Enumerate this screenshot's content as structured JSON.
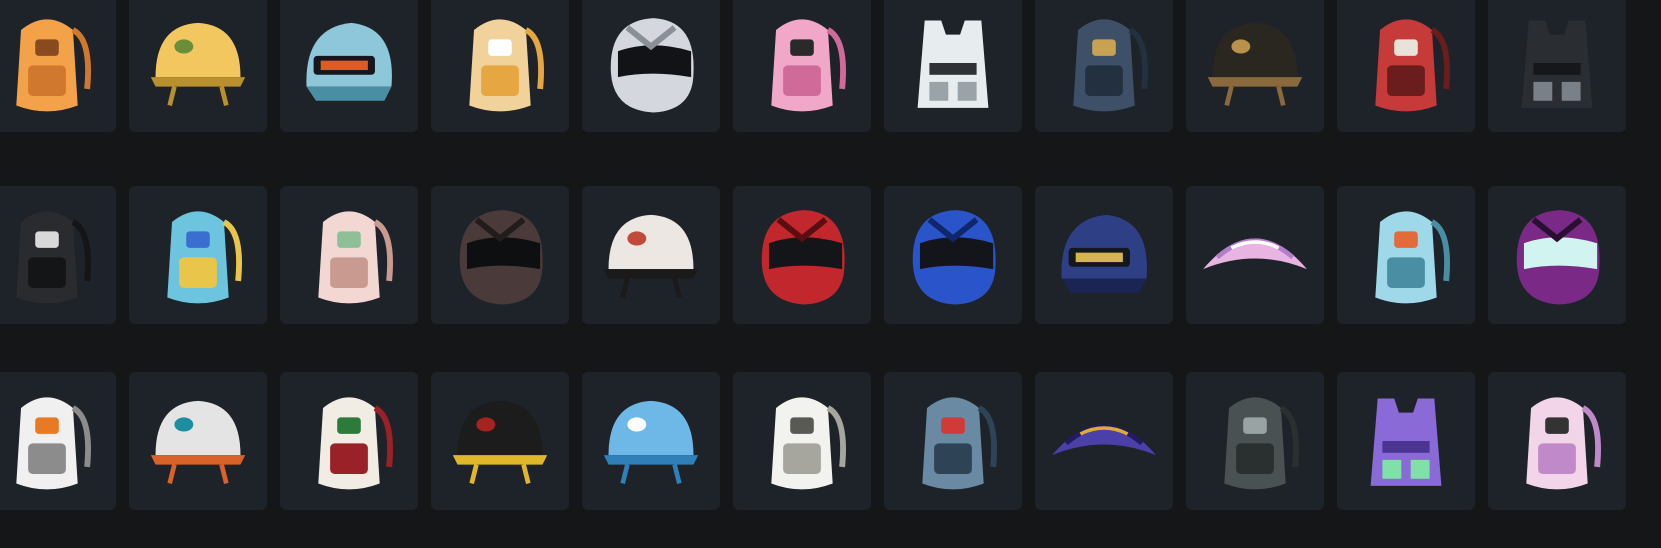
{
  "grid": {
    "rows": [
      {
        "items": [
          {
            "icon": "smiley-backpack-icon",
            "kind": "backpack",
            "c1": "#f4a24a",
            "c2": "#d0782e",
            "c3": "#8a4a20"
          },
          {
            "icon": "lemon-helmet-icon",
            "kind": "helmet",
            "c1": "#f2c760",
            "c2": "#b8902e",
            "c3": "#6a8f3a"
          },
          {
            "icon": "blue-level3-helmet-icon",
            "kind": "helmet3",
            "c1": "#8ec7d9",
            "c2": "#4a8ea4",
            "c3": "#e2582a"
          },
          {
            "icon": "puppy-backpack-icon",
            "kind": "backpack",
            "c1": "#f0d29a",
            "c2": "#e6a642",
            "c3": "#ffffff"
          },
          {
            "icon": "chrome-moto-helmet-icon",
            "kind": "moto",
            "c1": "#d4d8de",
            "c2": "#8a9098",
            "c3": "#111317"
          },
          {
            "icon": "pink-backpack-icon",
            "kind": "backpack",
            "c1": "#f1a8c8",
            "c2": "#d06a98",
            "c3": "#2a2a2a"
          },
          {
            "icon": "camo-vest-icon",
            "kind": "vest",
            "c1": "#e7ecef",
            "c2": "#2e3236",
            "c3": "#9aa3a8"
          },
          {
            "icon": "navy-backpack-icon",
            "kind": "backpack",
            "c1": "#3e5068",
            "c2": "#23303f",
            "c3": "#c7a252"
          },
          {
            "icon": "spiked-helmet-icon",
            "kind": "helmet",
            "c1": "#2a2620",
            "c2": "#8a6a3c",
            "c3": "#b8914a"
          },
          {
            "icon": "red-backpack-icon",
            "kind": "backpack",
            "c1": "#c63a3a",
            "c2": "#6b1c1c",
            "c3": "#e8e2d8"
          },
          {
            "icon": "black-vest-icon",
            "kind": "vest",
            "c1": "#2a2d31",
            "c2": "#15171a",
            "c3": "#7a8088"
          }
        ]
      },
      {
        "items": [
          {
            "icon": "wing-backpack-icon",
            "kind": "backpack",
            "c1": "#2a2b2e",
            "c2": "#141517",
            "c3": "#d9d9d9"
          },
          {
            "icon": "pixel-backpack-icon",
            "kind": "backpack",
            "c1": "#6cc4de",
            "c2": "#e9c64a",
            "c3": "#3a6fd1"
          },
          {
            "icon": "puppy-pouch-backpack-icon",
            "kind": "backpack",
            "c1": "#f2d7d3",
            "c2": "#c99a8f",
            "c3": "#8fbf96"
          },
          {
            "icon": "dark-pattern-helmet-icon",
            "kind": "moto",
            "c1": "#4a3a3a",
            "c2": "#231c1c",
            "c3": "#0e0f11"
          },
          {
            "icon": "dalmatian-helmet-icon",
            "kind": "helmet",
            "c1": "#ece7e2",
            "c2": "#1a1a1a",
            "c3": "#c24a3a"
          },
          {
            "icon": "red-moto-helmet-icon",
            "kind": "moto",
            "c1": "#c1272d",
            "c2": "#5a0e11",
            "c3": "#141518"
          },
          {
            "icon": "blue-moto-helmet-icon",
            "kind": "moto",
            "c1": "#2a54c9",
            "c2": "#10276d",
            "c3": "#13151b"
          },
          {
            "icon": "royal-level3-helmet-icon",
            "kind": "helmet3",
            "c1": "#2e3f86",
            "c2": "#1a2553",
            "c3": "#d6b352"
          },
          {
            "icon": "pink-parachute-icon",
            "kind": "parachute",
            "c1": "#e8b4e2",
            "c2": "#b27dc9",
            "c3": "#ffffff"
          },
          {
            "icon": "robot-backpack-icon",
            "kind": "backpack",
            "c1": "#9fd8e8",
            "c2": "#4a8ea4",
            "c3": "#e36a3a"
          },
          {
            "icon": "purple-moto-helmet-icon",
            "kind": "moto",
            "c1": "#7a2a86",
            "c2": "#2a0f33",
            "c3": "#d2f4f0"
          }
        ]
      },
      {
        "items": [
          {
            "icon": "snow-sports-backpack-icon",
            "kind": "backpack",
            "c1": "#f0f0f0",
            "c2": "#8c8c8c",
            "c3": "#e97a24"
          },
          {
            "icon": "goggle-helmet-icon",
            "kind": "helmet",
            "c1": "#e4e4e4",
            "c2": "#d9622a",
            "c3": "#1b8fa0"
          },
          {
            "icon": "festive-backpack-icon",
            "kind": "backpack",
            "c1": "#f1ece4",
            "c2": "#9a2127",
            "c3": "#2e7a3a"
          },
          {
            "icon": "music-helmet-icon",
            "kind": "helmet",
            "c1": "#1c1c1c",
            "c2": "#e0b62a",
            "c3": "#a6231f"
          },
          {
            "icon": "shark-helmet-icon",
            "kind": "helmet",
            "c1": "#6eb8e8",
            "c2": "#2f7fb8",
            "c3": "#ffffff"
          },
          {
            "icon": "white-ornate-backpack-icon",
            "kind": "backpack",
            "c1": "#f2f2ee",
            "c2": "#a6a59e",
            "c3": "#5a5a55"
          },
          {
            "icon": "shark-mouth-backpack-icon",
            "kind": "backpack",
            "c1": "#6a8aa4",
            "c2": "#2e4456",
            "c3": "#d23a3a"
          },
          {
            "icon": "galaxy-parachute-icon",
            "kind": "parachute",
            "c1": "#4b3fa8",
            "c2": "#231a63",
            "c3": "#e0a93a"
          },
          {
            "icon": "military-backpack-icon",
            "kind": "backpack",
            "c1": "#4a5152",
            "c2": "#2a2f30",
            "c3": "#9aa3a3"
          },
          {
            "icon": "purple-vest-icon",
            "kind": "vest",
            "c1": "#8a6ad6",
            "c2": "#4b3590",
            "c3": "#7fe0a8"
          },
          {
            "icon": "cartoon-backpack-icon",
            "kind": "backpack",
            "c1": "#f2d5e8",
            "c2": "#c08ac9",
            "c3": "#333333"
          }
        ]
      }
    ]
  }
}
